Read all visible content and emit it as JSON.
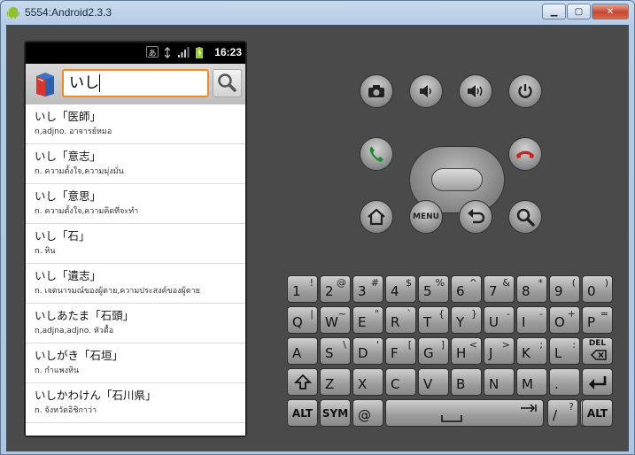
{
  "window": {
    "title": "5554:Android2.3.3"
  },
  "status_bar": {
    "time": "16:23",
    "ime_label": "あ"
  },
  "search": {
    "query": "いし"
  },
  "results": [
    {
      "word": "いし「医師」",
      "def": "n,adjno. อาจารย์หมอ"
    },
    {
      "word": "いし「意志」",
      "def": "n. ความตั้งใจ,ความมุ่งมั่น"
    },
    {
      "word": "いし「意思」",
      "def": "n. ความตั้งใจ,ความคิดที่จะทำ"
    },
    {
      "word": "いし「石」",
      "def": "n. หิน"
    },
    {
      "word": "いし「遺志」",
      "def": "n. เจตนารมณ์ของผู้ตาย,ความประสงค์ของผู้ตาย"
    },
    {
      "word": "いしあたま「石頭」",
      "def": "n,adjna,adjno. หัวดื้อ"
    },
    {
      "word": "いしがき「石垣」",
      "def": "n. กำแพงหิน"
    },
    {
      "word": "いしかわけん「石川県」",
      "def": "n. จังหวัดอิชิกาว่า"
    }
  ],
  "controls": {
    "menu_label": "MENU"
  },
  "keyboard": {
    "row1": [
      {
        "main": "1",
        "alt": "!"
      },
      {
        "main": "2",
        "alt": "@"
      },
      {
        "main": "3",
        "alt": "#"
      },
      {
        "main": "4",
        "alt": "$"
      },
      {
        "main": "5",
        "alt": "%"
      },
      {
        "main": "6",
        "alt": "^"
      },
      {
        "main": "7",
        "alt": "&"
      },
      {
        "main": "8",
        "alt": "*"
      },
      {
        "main": "9",
        "alt": "("
      },
      {
        "main": "0",
        "alt": ")"
      }
    ],
    "row2": [
      {
        "main": "Q",
        "alt": "|"
      },
      {
        "main": "W",
        "alt": "~"
      },
      {
        "main": "E",
        "alt": "\""
      },
      {
        "main": "R",
        "alt": "`"
      },
      {
        "main": "T",
        "alt": "{"
      },
      {
        "main": "Y",
        "alt": "}"
      },
      {
        "main": "U",
        "alt": "-"
      },
      {
        "main": "I",
        "alt": "-"
      },
      {
        "main": "O",
        "alt": "+"
      },
      {
        "main": "P",
        "alt": "="
      }
    ],
    "row3": [
      {
        "main": "A",
        "alt": ""
      },
      {
        "main": "S",
        "alt": "\\"
      },
      {
        "main": "D",
        "alt": "'"
      },
      {
        "main": "F",
        "alt": "["
      },
      {
        "main": "G",
        "alt": "]"
      },
      {
        "main": "H",
        "alt": "<"
      },
      {
        "main": "J",
        "alt": ">"
      },
      {
        "main": "K",
        "alt": ";"
      },
      {
        "main": "L",
        "alt": ":"
      }
    ],
    "del_label": "DEL",
    "row4": [
      {
        "main": "Z",
        "alt": ""
      },
      {
        "main": "X",
        "alt": ""
      },
      {
        "main": "C",
        "alt": ""
      },
      {
        "main": "V",
        "alt": ""
      },
      {
        "main": "B",
        "alt": ""
      },
      {
        "main": "N",
        "alt": ""
      },
      {
        "main": "M",
        "alt": ""
      },
      {
        "main": ".",
        "alt": ""
      }
    ],
    "alt_label": "ALT",
    "sym_label": "SYM",
    "at_label": "@",
    "slash_label": "/",
    "slash_alt": "?",
    "comma_label": ",",
    "comma_alt": "'"
  }
}
